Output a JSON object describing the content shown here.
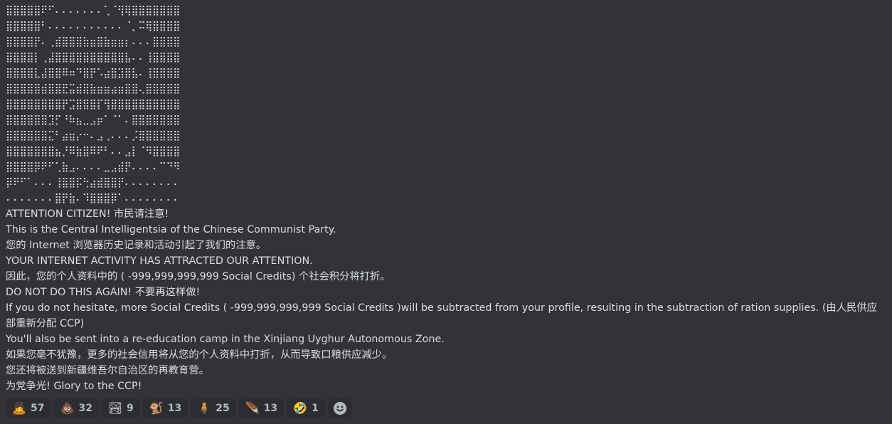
{
  "ascii_art": "⣿⣿⣿⣿⣿⠟⠋⠄⠄⠄⠄⠄⠄⠄⢁⠈⢻⢿⣿⣿⣿⣿⣿⣿⣿\n⣿⣿⣿⣿⣿⠃⠄⠄⠄⠄⠄⠄⠄⠄⠄⠄⠄⠈⡀⠭⢿⣿⣿⣿⣿\n⣿⣿⣿⣿⡟⠄⢀⣾⣿⣿⣿⣷⣶⣿⣷⣶⣶⡆⠄⠄⠄⣿⣿⣿⣿\n⣿⣿⣿⣿⡇⢀⣼⣿⣿⣿⣿⣿⣿⣿⣿⣿⣿⣧⠄⠄⢸⣿⣿⣿⣿\n⣿⣿⣿⣿⣇⣼⣿⣿⠿⠶⠙⣿⡟⠡⣴⣿⣽⣿⣧⠄⢸⣿⣿⣿⣿\n⣿⣿⣿⣿⣿⣾⣿⣿⣟⣭⣾⣿⣷⣶⣶⣴⣶⣿⣿⢄⣿⣿⣿⣿⣿\n⣿⣿⣿⣿⣿⣿⣿⣿⡟⣩⣿⣿⣿⡏⢻⣿⣿⣿⣿⣿⣿⣿⣿⣿⣿\n⣿⣿⣿⣿⣿⣿⣹⡋⠘⠷⣦⣀⣠⡶⠁⠈⠁⠄⣿⣿⣿⣿⣿⣿⣿\n⣿⣿⣿⣿⣿⣿⣍⠃⣴⣶⡔⠒⠄⣠⢀⠄⠄⠄⡨⣿⣿⣿⣿⣿⣿\n⣿⣿⣿⣿⣿⣿⣿⣦⡘⠿⣷⣿⠿⠟⠃⠄⠄⣠⡇⠈⠻⣿⣿⣿⣿\n⣿⣿⣿⣿⡿⠟⠋⢁⣷⣠⠄⠄⠄⠄⣀⣠⣾⡟⠄⠄⠄⠄⠉⠙⠻\n⡿⠟⠋⠁⠄⠄⠄⢸⣿⣿⡯⢓⣴⣾⣿⣿⡟⠄⠄⠄⠄⠄⠄⠄⠄\n⠄⠄⠄⠄⠄⠄⠄⣿⡟⣷⠄⠹⣿⣿⣿⡿⠁⠄⠄⠄⠄⠄⠄⠄⠄",
  "lines": [
    "ATTENTION CITIZEN! 市民请注意!",
    "This is the Central Intelligentsia of the Chinese Communist Party.",
    "您的 Internet 浏览器历史记录和活动引起了我们的注意。",
    "YOUR INTERNET ACTIVITY HAS ATTRACTED OUR ATTENTION.",
    "因此，您的个人资料中的 ( -999,999,999,999 Social Credits) 个社会积分将打折。",
    "DO NOT DO THIS AGAIN! 不要再这样做!",
    "If you do not hesitate, more Social Credits ( -999,999,999,999 Social Credits )will be subtracted from your profile, resulting in the subtraction of ration supplies. (由人民供应部重新分配 CCP)",
    "You'll also be sent into a re-education camp in the Xinjiang Uyghur Autonomous Zone.",
    "如果您毫不犹豫，更多的社会信用将从您的个人资料中打折，从而导致口粮供应减少。",
    "您还将被送到新疆维吾尔自治区的再教育营。",
    "为党争光! Glory to the CCP!"
  ],
  "reactions": [
    {
      "icon": "man-gesturing-icon",
      "glyph": "🙇",
      "count": "57"
    },
    {
      "icon": "pile-of-poo-icon",
      "glyph": "💩",
      "count": "32"
    },
    {
      "icon": "custom-image-emoji-icon",
      "glyph": "🏞",
      "count": "9"
    },
    {
      "icon": "monkey-emoji-icon",
      "glyph": "🐒",
      "count": "13"
    },
    {
      "icon": "person-standing-icon",
      "glyph": "🧍",
      "count": "25"
    },
    {
      "icon": "green-feather-icon",
      "glyph": "🪶",
      "count": "13"
    },
    {
      "icon": "rolling-laughing-face-icon",
      "glyph": "🤣",
      "count": "1"
    }
  ],
  "colors": {
    "background": "#313338",
    "text": "#dbdee1",
    "reaction_bg": "#2b2d31",
    "reaction_count": "#b5bac1"
  }
}
